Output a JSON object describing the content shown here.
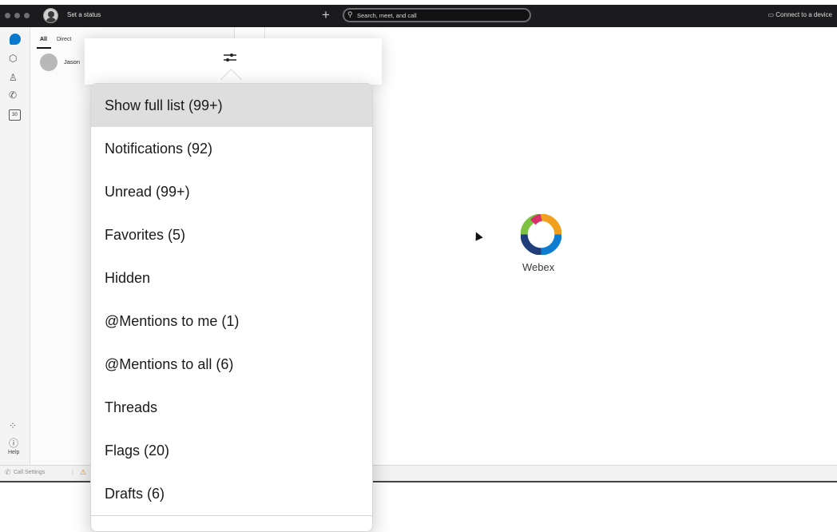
{
  "titlebar": {
    "status_label": "Set a status",
    "plus_glyph": "+",
    "search_placeholder": "Search, meet, and call",
    "connect_label": "Connect to a device"
  },
  "rail": {
    "help_label": "Help",
    "calendar_day": "30"
  },
  "list": {
    "tab_all": "All",
    "tab_direct": "Direct",
    "contact_name": "Jason"
  },
  "filter_menu": {
    "items": [
      {
        "label": "Show full list (99+)",
        "selected": true
      },
      {
        "label": "Notifications (92)"
      },
      {
        "label": "Unread (99+)"
      },
      {
        "label": "Favorites (5)"
      },
      {
        "label": "Hidden"
      },
      {
        "label": "@Mentions to me (1)"
      },
      {
        "label": "@Mentions to all (6)"
      },
      {
        "label": "Threads"
      },
      {
        "label": "Flags (20)"
      },
      {
        "label": "Drafts (6)"
      }
    ]
  },
  "main": {
    "logo_text": "Webex"
  },
  "bottombar": {
    "call_settings_label": "Call Settings"
  },
  "colors": {
    "titlebar_bg": "#1b1b1d",
    "accent_blue": "#0a78cc",
    "selected_row": "#dedede",
    "warning_orange": "#e08a1c"
  }
}
